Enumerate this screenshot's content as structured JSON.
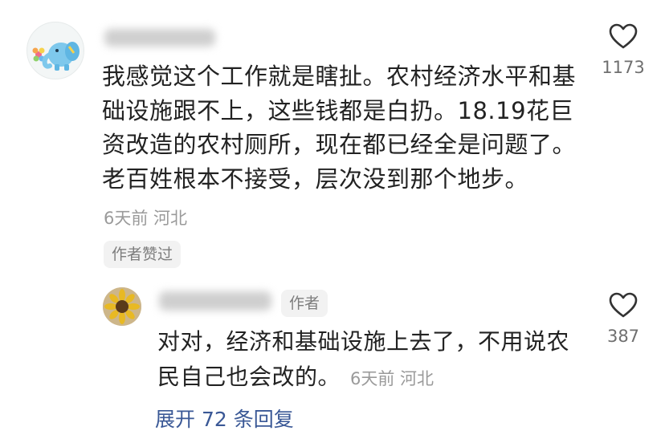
{
  "comment": {
    "text": "我感觉这个工作就是瞎扯。农村经济水平和基础设施跟不上，这些钱都是白扔。18.19花巨资改造的农村厕所，现在都已经全是问题了。老百姓根本不接受，层次没到那个地步。",
    "meta": "6天前 河北",
    "author_liked_label": "作者赞过",
    "like_count": "1173"
  },
  "reply": {
    "author_badge": "作者",
    "text": "对对，经济和基础设施上去了，不用说农民自己也会改的。",
    "meta": "6天前 河北",
    "like_count": "387"
  },
  "expand_replies_label": "展开 72 条回复",
  "colors": {
    "link": "#3a5896",
    "meta": "#9a9a9a",
    "chip_bg": "#f2f2f2"
  }
}
